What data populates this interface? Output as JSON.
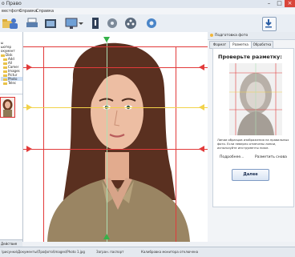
{
  "window": {
    "title": "о Право",
    "minimize": "–",
    "maximize": "□",
    "close": "×"
  },
  "menu": {
    "items": [
      "вестфото",
      "Справка",
      "Справка"
    ]
  },
  "toolbar": {
    "buttons": [
      "open-icon",
      "photo-icon",
      "print-icon",
      "camera-icon",
      "display-icon",
      "info-icon",
      "settings-icon",
      "film-icon",
      "gear-icon",
      "download-icon"
    ]
  },
  "tree": {
    "items": [
      "ы",
      "ьютер",
      "окумент",
      "Disk",
      "Add",
      "All",
      "Camer",
      "Images",
      "Pictur",
      "Photo",
      "Telec"
    ]
  },
  "left_footer": "Действия",
  "right_panel": {
    "header": "Подготовка фото",
    "tabs": [
      "Формат",
      "Разметка",
      "Обработка"
    ],
    "title": "Проверьте разметку:",
    "help": "Линии образцов изображения на правильных фото. Если неверно отмечены линии, используйте инструменты ниже.",
    "link_more": "Подробнее...",
    "link_show": "Разметить снова",
    "next_button": "Далее"
  },
  "status": {
    "path": "\\рисунки\\Документы\\Профото\\Images\\Photo 1.jpg",
    "label": "Загран. паспорт",
    "info": "Калибровка монитора отключена"
  },
  "colors": {
    "guide_red": "#e23a3a",
    "guide_yellow": "#f2d24a",
    "handle_green": "#35b249",
    "accent_blue": "#3a6fb6"
  }
}
